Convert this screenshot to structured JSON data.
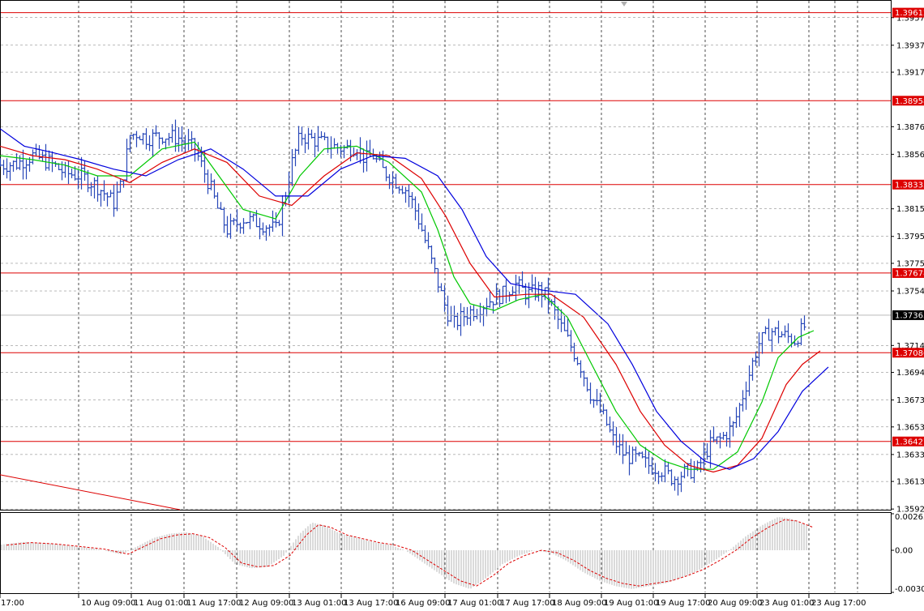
{
  "chart_data": [
    {
      "type": "candlestick",
      "symbol_panel": "main",
      "price_axis": {
        "ticks": [
          "1.39575",
          "1.39370",
          "1.39170",
          "1.38765",
          "1.38560",
          "1.38155",
          "1.37950",
          "1.37750",
          "1.37545",
          "1.37140",
          "1.36940",
          "1.36735",
          "1.36535",
          "1.36330",
          "1.36130",
          "1.35925"
        ],
        "ylim": [
          1.3592,
          1.397
        ]
      },
      "time_axis": {
        "ticks": [
          "17:00",
          "10 Aug 09:00",
          "11 Aug 01:00",
          "11 Aug 17:00",
          "12 Aug 09:00",
          "13 Aug 01:00",
          "13 Aug 17:00",
          "16 Aug 09:00",
          "17 Aug 01:00",
          "17 Aug 17:00",
          "18 Aug 09:00",
          "19 Aug 01:00",
          "19 Aug 17:00",
          "20 Aug 09:00",
          "23 Aug 01:00",
          "23 Aug 17:00"
        ]
      },
      "current_price": "1.37365",
      "horizontal_levels": [
        {
          "label": "1.39612",
          "value": 1.39612
        },
        {
          "label": "1.38958",
          "value": 1.38958
        },
        {
          "label": "1.38335",
          "value": 1.38335
        },
        {
          "label": "1.37678",
          "value": 1.37678
        },
        {
          "label": "1.37086",
          "value": 1.37086
        },
        {
          "label": "1.36427",
          "value": 1.36427
        }
      ],
      "trendline": {
        "from_value": 1.3618,
        "to_value": 1.3592
      },
      "close_path": [
        [
          0,
          1.3848
        ],
        [
          20,
          1.3849
        ],
        [
          40,
          1.3855
        ],
        [
          60,
          1.385
        ],
        [
          80,
          1.3842
        ],
        [
          100,
          1.384
        ],
        [
          120,
          1.3832
        ],
        [
          140,
          1.382
        ],
        [
          150,
          1.3835
        ],
        [
          160,
          1.387
        ],
        [
          170,
          1.3872
        ],
        [
          180,
          1.3868
        ],
        [
          200,
          1.387
        ],
        [
          220,
          1.3868
        ],
        [
          240,
          1.386
        ],
        [
          250,
          1.3845
        ],
        [
          260,
          1.383
        ],
        [
          270,
          1.3812
        ],
        [
          280,
          1.38
        ],
        [
          300,
          1.3808
        ],
        [
          320,
          1.3805
        ],
        [
          340,
          1.38
        ],
        [
          350,
          1.3822
        ],
        [
          360,
          1.385
        ],
        [
          370,
          1.387
        ],
        [
          390,
          1.3866
        ],
        [
          410,
          1.3862
        ],
        [
          425,
          1.386
        ],
        [
          440,
          1.3862
        ],
        [
          450,
          1.3852
        ],
        [
          460,
          1.3855
        ],
        [
          470,
          1.3845
        ],
        [
          480,
          1.384
        ],
        [
          490,
          1.3835
        ],
        [
          500,
          1.383
        ],
        [
          510,
          1.3818
        ],
        [
          520,
          1.38
        ],
        [
          530,
          1.378
        ],
        [
          540,
          1.376
        ],
        [
          550,
          1.374
        ],
        [
          560,
          1.373
        ],
        [
          575,
          1.3738
        ],
        [
          590,
          1.3742
        ],
        [
          605,
          1.3748
        ],
        [
          620,
          1.3752
        ],
        [
          635,
          1.376
        ],
        [
          650,
          1.3752
        ],
        [
          665,
          1.3755
        ],
        [
          675,
          1.375
        ],
        [
          690,
          1.373
        ],
        [
          700,
          1.3718
        ],
        [
          715,
          1.37
        ],
        [
          730,
          1.3675
        ],
        [
          745,
          1.366
        ],
        [
          755,
          1.3645
        ],
        [
          770,
          1.3632
        ],
        [
          785,
          1.363
        ],
        [
          800,
          1.3625
        ],
        [
          815,
          1.3622
        ],
        [
          830,
          1.3615
        ],
        [
          845,
          1.362
        ],
        [
          860,
          1.3622
        ],
        [
          875,
          1.364
        ],
        [
          890,
          1.3645
        ],
        [
          905,
          1.3655
        ],
        [
          920,
          1.3685
        ],
        [
          935,
          1.3715
        ],
        [
          950,
          1.3725
        ],
        [
          965,
          1.3722
        ],
        [
          980,
          1.3718
        ],
        [
          992,
          1.3728
        ]
      ],
      "moving_averages": [
        {
          "color": "#00c800",
          "path": [
            [
              0,
              1.3855
            ],
            [
              40,
              1.3852
            ],
            [
              80,
              1.3848
            ],
            [
              120,
              1.384
            ],
            [
              160,
              1.384
            ],
            [
              200,
              1.386
            ],
            [
              240,
              1.3865
            ],
            [
              270,
              1.384
            ],
            [
              300,
              1.3815
            ],
            [
              340,
              1.3808
            ],
            [
              370,
              1.384
            ],
            [
              400,
              1.386
            ],
            [
              440,
              1.3862
            ],
            [
              480,
              1.385
            ],
            [
              520,
              1.3828
            ],
            [
              540,
              1.38
            ],
            [
              560,
              1.3765
            ],
            [
              580,
              1.3745
            ],
            [
              610,
              1.374
            ],
            [
              640,
              1.3748
            ],
            [
              670,
              1.3752
            ],
            [
              700,
              1.3735
            ],
            [
              730,
              1.37
            ],
            [
              760,
              1.3665
            ],
            [
              790,
              1.364
            ],
            [
              820,
              1.3628
            ],
            [
              850,
              1.3622
            ],
            [
              880,
              1.3622
            ],
            [
              910,
              1.3635
            ],
            [
              940,
              1.3672
            ],
            [
              960,
              1.3705
            ],
            [
              985,
              1.372
            ],
            [
              1004,
              1.3725
            ]
          ]
        },
        {
          "color": "#dd0000",
          "path": [
            [
              0,
              1.3862
            ],
            [
              40,
              1.3855
            ],
            [
              80,
              1.3852
            ],
            [
              120,
              1.3845
            ],
            [
              160,
              1.3835
            ],
            [
              200,
              1.385
            ],
            [
              240,
              1.386
            ],
            [
              280,
              1.385
            ],
            [
              320,
              1.3825
            ],
            [
              360,
              1.3818
            ],
            [
              400,
              1.384
            ],
            [
              440,
              1.3857
            ],
            [
              480,
              1.3855
            ],
            [
              520,
              1.3838
            ],
            [
              550,
              1.381
            ],
            [
              580,
              1.3775
            ],
            [
              610,
              1.375
            ],
            [
              650,
              1.3752
            ],
            [
              680,
              1.3752
            ],
            [
              720,
              1.3735
            ],
            [
              760,
              1.37
            ],
            [
              790,
              1.3665
            ],
            [
              820,
              1.364
            ],
            [
              850,
              1.3625
            ],
            [
              880,
              1.362
            ],
            [
              910,
              1.3625
            ],
            [
              940,
              1.3645
            ],
            [
              970,
              1.3685
            ],
            [
              990,
              1.37
            ],
            [
              1012,
              1.371
            ]
          ]
        },
        {
          "color": "#0000dd",
          "path": [
            [
              0,
              1.3875
            ],
            [
              30,
              1.3862
            ],
            [
              60,
              1.3858
            ],
            [
              100,
              1.3852
            ],
            [
              140,
              1.3845
            ],
            [
              180,
              1.384
            ],
            [
              220,
              1.3852
            ],
            [
              260,
              1.386
            ],
            [
              300,
              1.3845
            ],
            [
              340,
              1.3825
            ],
            [
              380,
              1.3825
            ],
            [
              420,
              1.3845
            ],
            [
              460,
              1.3855
            ],
            [
              500,
              1.3853
            ],
            [
              540,
              1.384
            ],
            [
              570,
              1.3815
            ],
            [
              600,
              1.378
            ],
            [
              630,
              1.376
            ],
            [
              670,
              1.3755
            ],
            [
              710,
              1.3752
            ],
            [
              750,
              1.373
            ],
            [
              780,
              1.37
            ],
            [
              810,
              1.3665
            ],
            [
              840,
              1.3643
            ],
            [
              870,
              1.3628
            ],
            [
              900,
              1.3622
            ],
            [
              930,
              1.363
            ],
            [
              960,
              1.365
            ],
            [
              990,
              1.368
            ],
            [
              1022,
              1.3698
            ]
          ]
        }
      ]
    },
    {
      "type": "oscillator",
      "symbol_panel": "indicator",
      "scale_labels": [
        "0.002635",
        "0.00",
        "-0.00304"
      ],
      "ylim": [
        -0.00304,
        0.002635
      ],
      "histogram_samples": [
        [
          0,
          0.0004
        ],
        [
          30,
          0.0006
        ],
        [
          60,
          0.0005
        ],
        [
          90,
          0.0003
        ],
        [
          120,
          0.0001
        ],
        [
          150,
          -0.0003
        ],
        [
          170,
          0.0003
        ],
        [
          190,
          0.0009
        ],
        [
          210,
          0.0012
        ],
        [
          230,
          0.0013
        ],
        [
          250,
          0.001
        ],
        [
          270,
          0.0002
        ],
        [
          290,
          -0.001
        ],
        [
          310,
          -0.0013
        ],
        [
          330,
          -0.0012
        ],
        [
          350,
          -0.0004
        ],
        [
          370,
          0.0012
        ],
        [
          385,
          0.002
        ],
        [
          400,
          0.0018
        ],
        [
          420,
          0.0012
        ],
        [
          440,
          0.0009
        ],
        [
          460,
          0.0006
        ],
        [
          480,
          0.0004
        ],
        [
          500,
          0.0
        ],
        [
          520,
          -0.0008
        ],
        [
          540,
          -0.0016
        ],
        [
          560,
          -0.0024
        ],
        [
          580,
          -0.0028
        ],
        [
          600,
          -0.002
        ],
        [
          620,
          -0.001
        ],
        [
          640,
          -0.0004
        ],
        [
          660,
          0.0
        ],
        [
          680,
          -0.0002
        ],
        [
          700,
          -0.0008
        ],
        [
          720,
          -0.0016
        ],
        [
          740,
          -0.0022
        ],
        [
          760,
          -0.0026
        ],
        [
          780,
          -0.0028
        ],
        [
          800,
          -0.0026
        ],
        [
          820,
          -0.0024
        ],
        [
          840,
          -0.002
        ],
        [
          860,
          -0.0015
        ],
        [
          880,
          -0.0008
        ],
        [
          900,
          0.0
        ],
        [
          920,
          0.001
        ],
        [
          940,
          0.0018
        ],
        [
          960,
          0.0024
        ],
        [
          975,
          0.0023
        ],
        [
          995,
          0.0018
        ]
      ],
      "signal_color": "#dd0000"
    }
  ],
  "colors": {
    "background": "#ffffff",
    "grid": "#000000",
    "bar": "#2848b8",
    "level_line": "#dd0000",
    "level_tag_bg": "#dd0000",
    "current_tag_bg": "#000000",
    "histogram": "#b4b4b4"
  }
}
